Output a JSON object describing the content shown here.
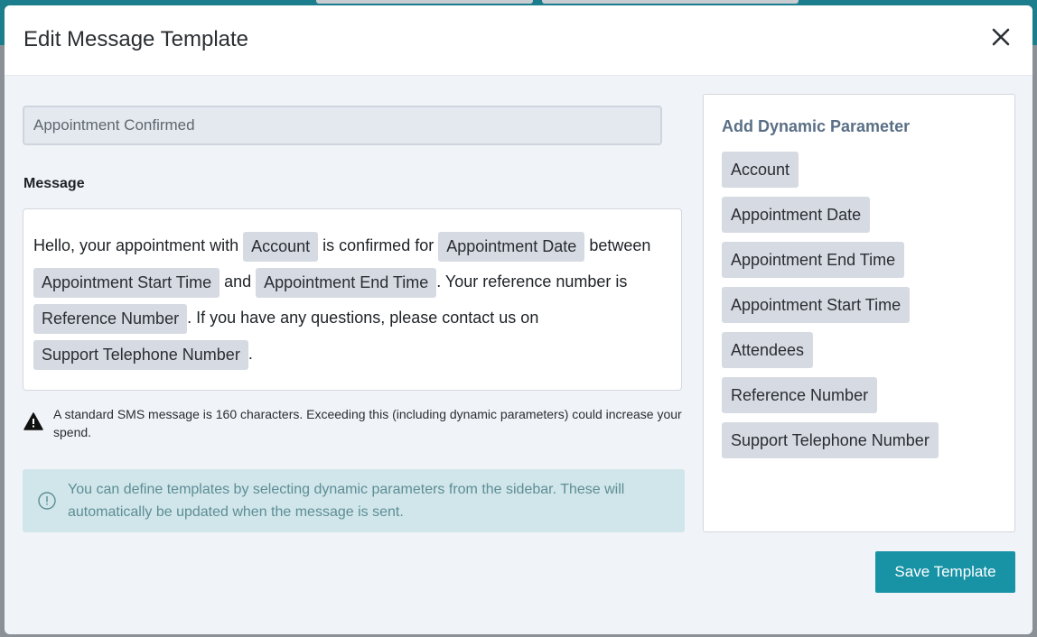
{
  "modal": {
    "title": "Edit Message Template",
    "close_icon": "close-icon"
  },
  "template_name": {
    "value": "Appointment Confirmed"
  },
  "message": {
    "label": "Message",
    "segments": {
      "t1": "Hello, your appointment with ",
      "p1": "Account",
      "t2": " is confirmed for ",
      "p2": "Appointment Date",
      "t3": " between ",
      "p3": "Appointment Start Time",
      "t4": " and ",
      "p4": "Appointment End Time",
      "t5": ". Your reference number is ",
      "p5": "Reference Number",
      "t6": ". If you have any questions, please contact us on ",
      "p6": "Support Telephone Number",
      "t7": "."
    }
  },
  "warning": {
    "icon": "warning-icon",
    "text": "A standard SMS message is 160 characters. Exceeding this (including dynamic parameters) could increase your spend."
  },
  "info": {
    "icon": "info-icon",
    "text": "You can define templates by selecting dynamic parameters from the sidebar. These will automatically be updated when the message is sent."
  },
  "sidebar": {
    "title": "Add Dynamic Parameter",
    "params": [
      "Account",
      "Appointment Date",
      "Appointment End Time",
      "Appointment Start Time",
      "Attendees",
      "Reference Number",
      "Support Telephone Number"
    ]
  },
  "actions": {
    "save_label": "Save Template"
  },
  "colors": {
    "accent": "#1893a6",
    "chip_bg": "#d6dae2",
    "info_bg": "#d0e6ea",
    "sidebar_title": "#5a6f86"
  }
}
